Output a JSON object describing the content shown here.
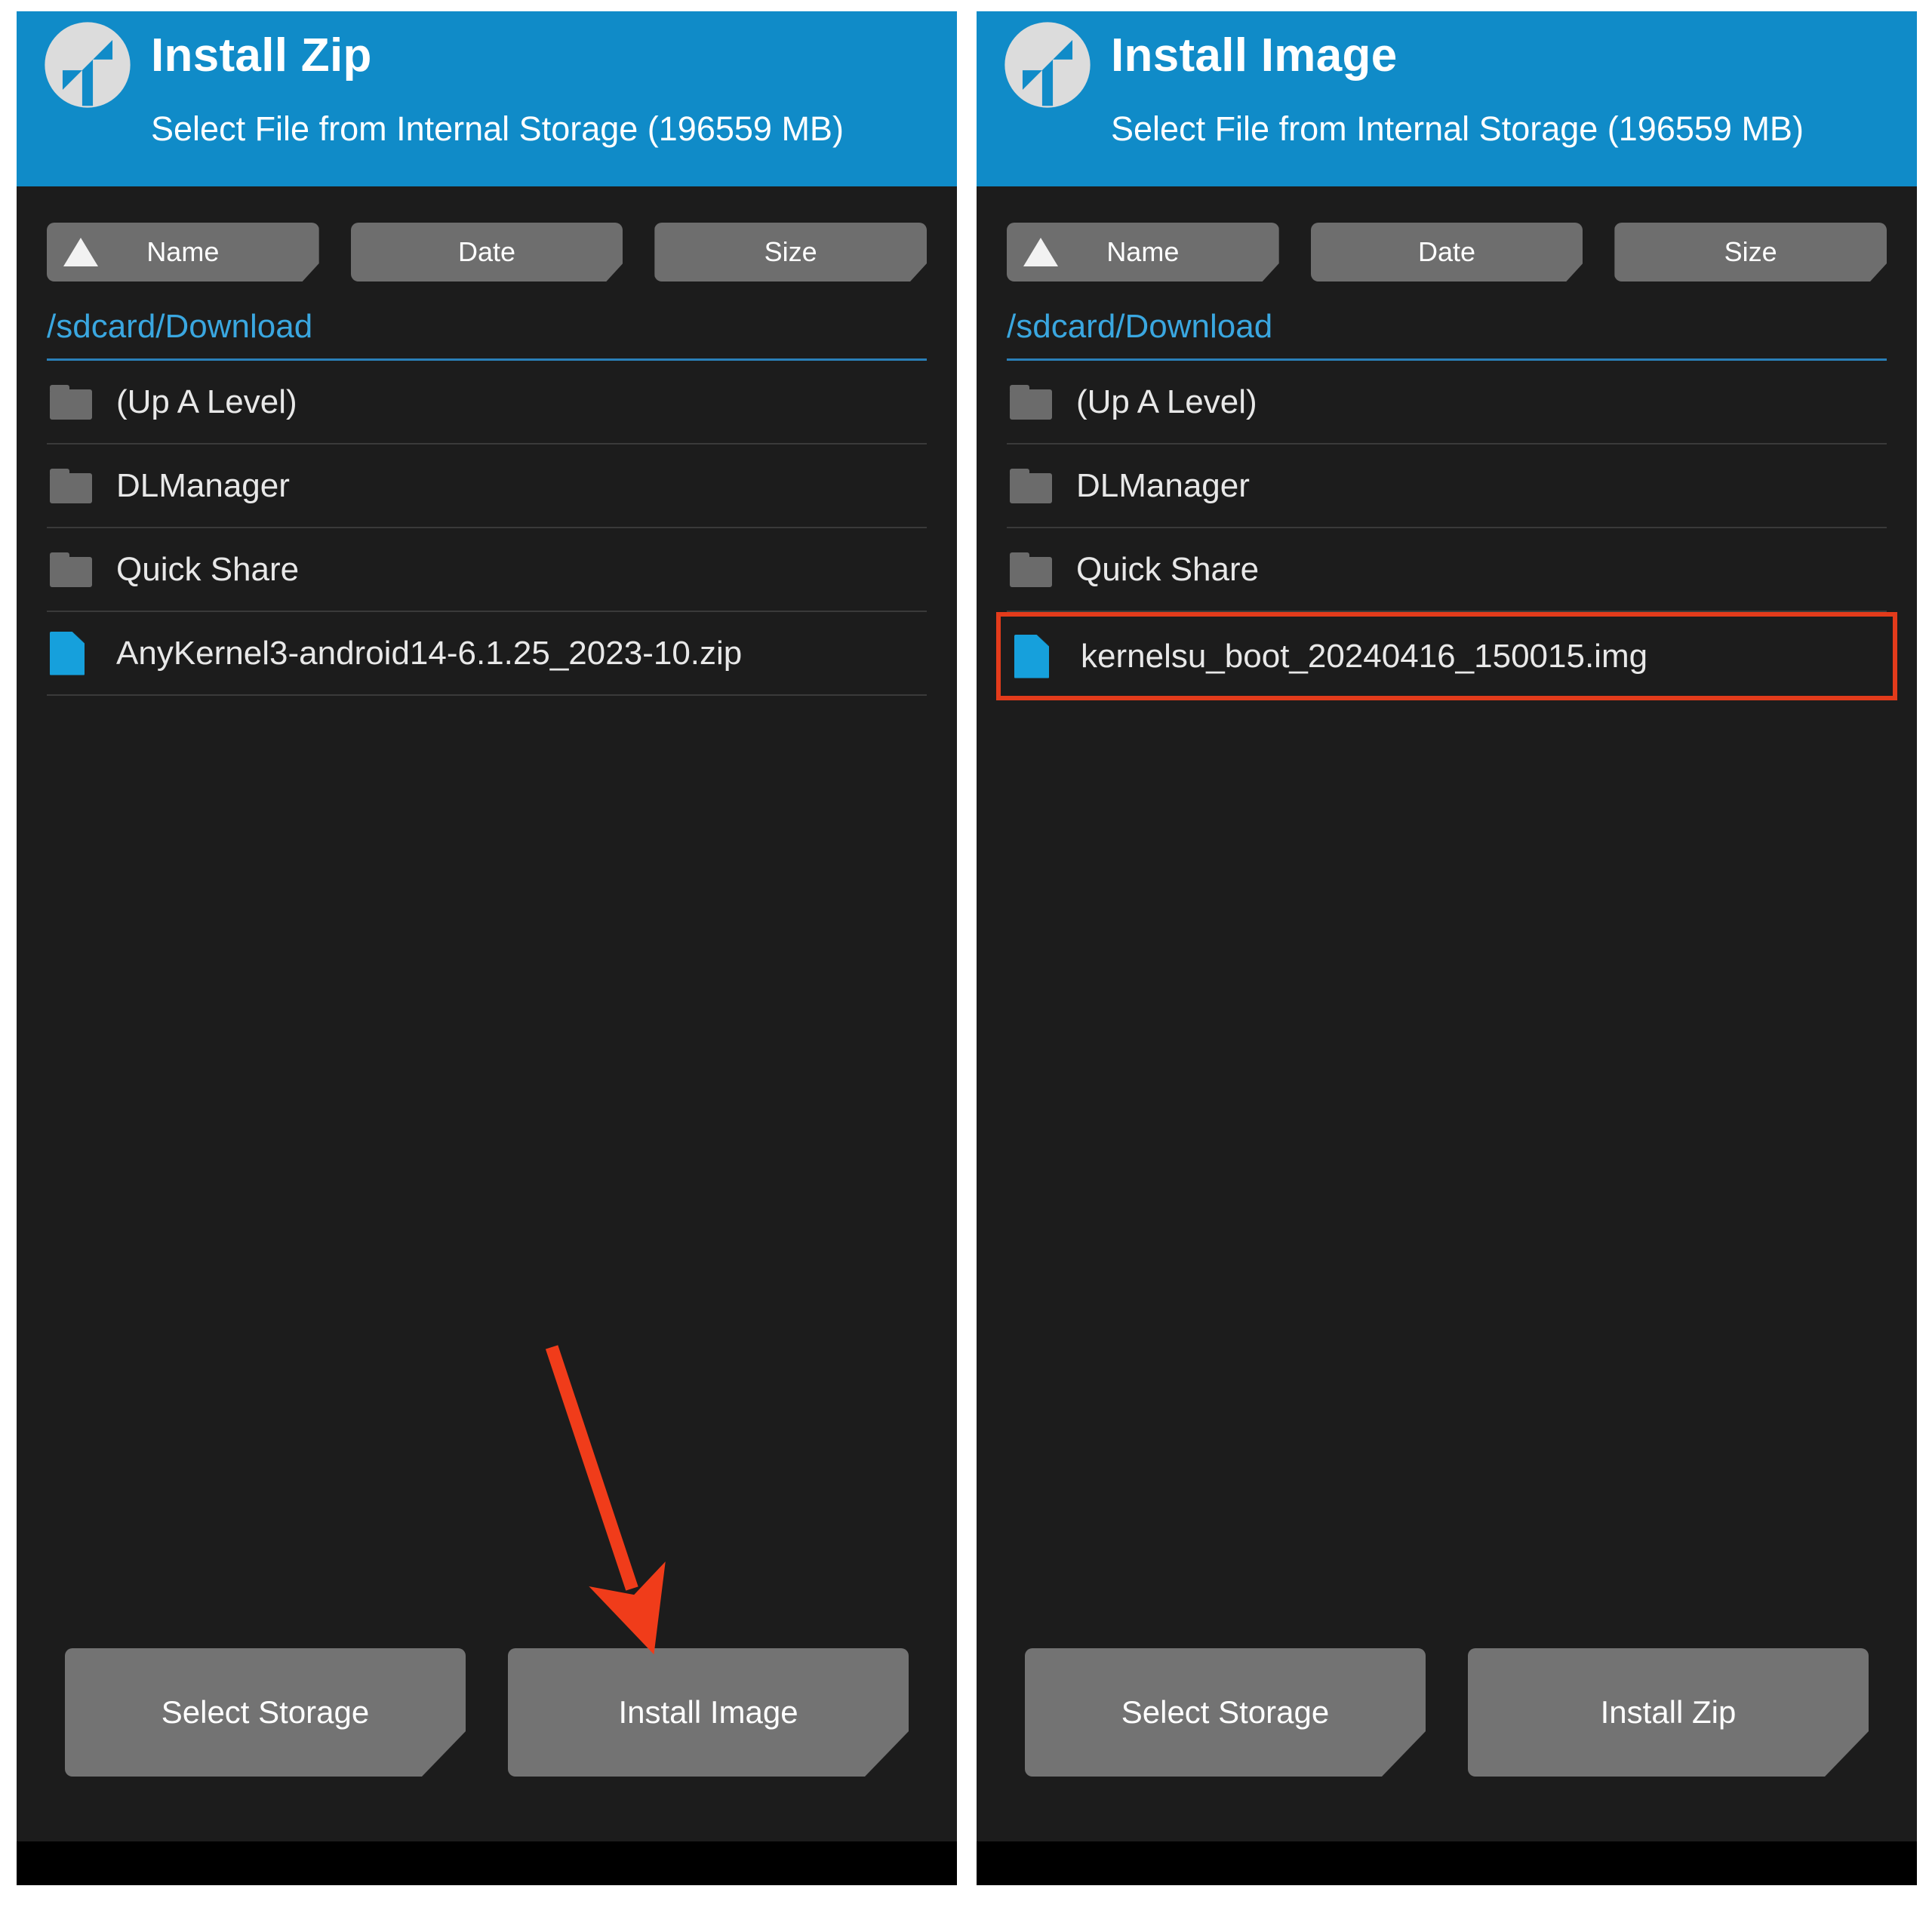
{
  "panels": [
    {
      "id": "install-zip",
      "header": {
        "logo_icon": "twrp-logo-icon",
        "title": "Install Zip",
        "subtitle": "Select File from Internal Storage (196559 MB)"
      },
      "sort_buttons": [
        {
          "label": "Name",
          "active": true,
          "icon": "sort-ascending-triangle-icon"
        },
        {
          "label": "Date",
          "active": false
        },
        {
          "label": "Size",
          "active": false
        }
      ],
      "path": "/sdcard/Download",
      "rows": [
        {
          "label": "(Up A Level)",
          "type": "folder",
          "icon": "folder-icon",
          "highlighted": false
        },
        {
          "label": "DLManager",
          "type": "folder",
          "icon": "folder-icon",
          "highlighted": false
        },
        {
          "label": "Quick Share",
          "type": "folder",
          "icon": "folder-icon",
          "highlighted": false
        },
        {
          "label": "AnyKernel3-android14-6.1.25_2023-10.zip",
          "type": "file",
          "icon": "file-icon",
          "highlighted": false
        }
      ],
      "actions": [
        {
          "label": "Select Storage"
        },
        {
          "label": "Install Image"
        }
      ],
      "annotation": {
        "type": "arrow",
        "color": "#f03c1a",
        "points_to": "Install Image"
      }
    },
    {
      "id": "install-image",
      "header": {
        "logo_icon": "twrp-logo-icon",
        "title": "Install Image",
        "subtitle": "Select File from Internal Storage (196559 MB)"
      },
      "sort_buttons": [
        {
          "label": "Name",
          "active": true,
          "icon": "sort-ascending-triangle-icon"
        },
        {
          "label": "Date",
          "active": false
        },
        {
          "label": "Size",
          "active": false
        }
      ],
      "path": "/sdcard/Download",
      "rows": [
        {
          "label": "(Up A Level)",
          "type": "folder",
          "icon": "folder-icon",
          "highlighted": false
        },
        {
          "label": "DLManager",
          "type": "folder",
          "icon": "folder-icon",
          "highlighted": false
        },
        {
          "label": "Quick Share",
          "type": "folder",
          "icon": "folder-icon",
          "highlighted": false
        },
        {
          "label": "kernelsu_boot_20240416_150015.img",
          "type": "file",
          "icon": "file-icon",
          "highlighted": true
        }
      ],
      "actions": [
        {
          "label": "Select Storage"
        },
        {
          "label": "Install Zip"
        }
      ],
      "annotation": null
    }
  ],
  "colors": {
    "header_blue": "#108bc8",
    "background": "#1c1c1c",
    "path_blue": "#3aa7e0",
    "file_icon_blue": "#16a0dc",
    "folder_grey": "#6b6b6b",
    "button_grey": "#737373",
    "sort_button_grey": "#6e6e6e",
    "highlight_red": "#e33b1b",
    "arrow_red": "#f03c1a",
    "text": "#e8e8e8"
  }
}
